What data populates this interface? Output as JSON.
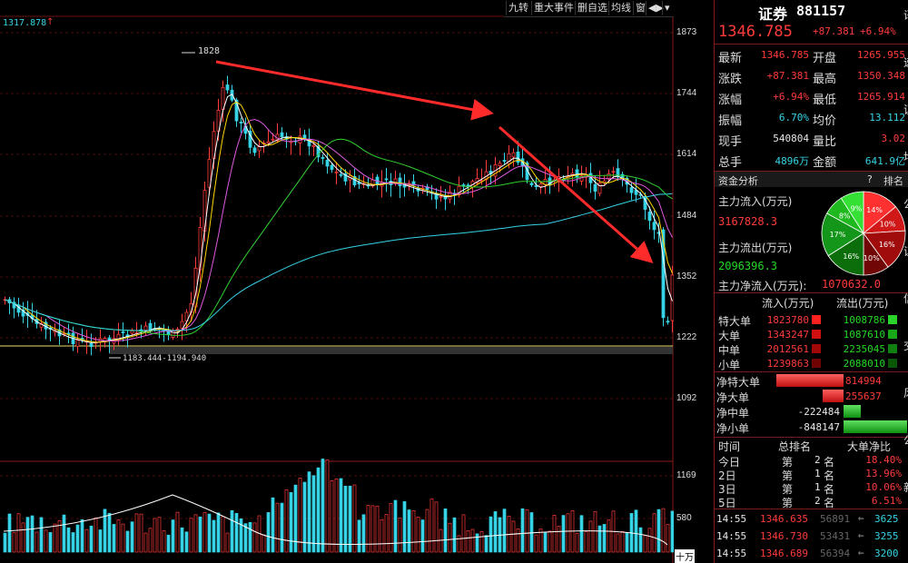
{
  "colors": {
    "up": "#ff3b3b",
    "down": "#26d926",
    "accent": "#36d3e6",
    "bg": "#000000"
  },
  "toolbar": {
    "items": [
      "九转",
      "重大事件",
      "删自选",
      "均线",
      "窗"
    ],
    "arrow_label": "◀▶"
  },
  "chart": {
    "top_value": "1317.878",
    "high_label": "1828",
    "low_label": "1183.444-1194.940",
    "price_axis": [
      "1873",
      "1744",
      "1614",
      "1484",
      "1352",
      "1222",
      "1092"
    ],
    "volume_axis": [
      "1169",
      "580",
      "十万"
    ]
  },
  "quote": {
    "name": "证券",
    "code": "881157",
    "price": "1346.785",
    "change": "+87.381",
    "pct": "+6.94%",
    "rows": [
      {
        "l1": "最新",
        "v1": "1346.785",
        "c1": "red",
        "l2": "开盘",
        "v2": "1265.955",
        "c2": "red"
      },
      {
        "l1": "涨跌",
        "v1": "+87.381",
        "c1": "red",
        "l2": "最高",
        "v2": "1350.348",
        "c2": "red"
      },
      {
        "l1": "涨幅",
        "v1": "+6.94%",
        "c1": "red",
        "l2": "最低",
        "v2": "1265.914",
        "c2": "red"
      },
      {
        "l1": "振幅",
        "v1": "6.70%",
        "c1": "cyan",
        "l2": "均价",
        "v2": "13.112",
        "c2": "cyan"
      },
      {
        "l1": "现手",
        "v1": "540804",
        "c1": "white",
        "l2": "量比",
        "v2": "3.02",
        "c2": "red"
      },
      {
        "l1": "总手",
        "v1": "4896万",
        "c1": "cyan",
        "l2": "金额",
        "v2": "641.9亿",
        "c2": "cyan"
      }
    ]
  },
  "fund": {
    "title": "资金分析",
    "help": "?",
    "rank": "排名",
    "inflow_label": "主力流入(万元)",
    "inflow_value": "3167828.3",
    "outflow_label": "主力流出(万元)",
    "outflow_value": "2096396.3",
    "net_label": "主力净流入(万元):",
    "net_value": "1070632.0",
    "pie": [
      {
        "label": "14%",
        "value": 14,
        "color": "#ff3030"
      },
      {
        "label": "10%",
        "value": 10,
        "color": "#d01818"
      },
      {
        "label": "16%",
        "value": 16,
        "color": "#a00c0c"
      },
      {
        "label": "10%",
        "value": 10,
        "color": "#700606"
      },
      {
        "label": "16%",
        "value": 16,
        "color": "#0b6e0b"
      },
      {
        "label": "17%",
        "value": 17,
        "color": "#14961a"
      },
      {
        "label": "8%",
        "value": 8,
        "color": "#1fb81f"
      },
      {
        "label": "9%",
        "value": 9,
        "color": "#35e035"
      }
    ]
  },
  "flows": {
    "header": [
      "流入(万元)",
      "流出(万元)"
    ],
    "rows": [
      {
        "label": "特大单",
        "in": "1823780",
        "out": "1008786",
        "inc": "#ff2020",
        "outc": "#2bd42b"
      },
      {
        "label": "大单",
        "in": "1343247",
        "out": "1087610",
        "inc": "#d01010",
        "outc": "#18a818"
      },
      {
        "label": "中单",
        "in": "2012561",
        "out": "2235045",
        "inc": "#a00808",
        "outc": "#108010"
      },
      {
        "label": "小单",
        "in": "1239863",
        "out": "2088010",
        "inc": "#700404",
        "outc": "#085808"
      }
    ]
  },
  "net": {
    "rows": [
      {
        "label": "净特大单",
        "value": "814994",
        "frac": 1.0,
        "sign": 1
      },
      {
        "label": "净大单",
        "value": "255637",
        "frac": 0.31,
        "sign": 1
      },
      {
        "label": "净中单",
        "value": "-222484",
        "frac": 0.27,
        "sign": -1
      },
      {
        "label": "净小单",
        "value": "-848147",
        "frac": 1.0,
        "sign": -1
      }
    ]
  },
  "rank": {
    "header": [
      "时间",
      "总排名",
      "大单净比"
    ],
    "rows": [
      {
        "t": "今日",
        "d": "第",
        "n": "2",
        "u": "名",
        "p": "18.40%"
      },
      {
        "t": "2日",
        "d": "第",
        "n": "1",
        "u": "名",
        "p": "13.96%"
      },
      {
        "t": "3日",
        "d": "第",
        "n": "1",
        "u": "名",
        "p": "10.06%"
      },
      {
        "t": "5日",
        "d": "第",
        "n": "2",
        "u": "名",
        "p": "6.51%"
      }
    ]
  },
  "ticks": [
    {
      "time": "14:55",
      "price": "1346.635",
      "vol": "56891",
      "arrow": "⇐",
      "amt": "3625"
    },
    {
      "time": "14:55",
      "price": "1346.730",
      "vol": "53431",
      "arrow": "⇐",
      "amt": "3255"
    },
    {
      "time": "14:55",
      "price": "1346.689",
      "vol": "56394",
      "arrow": "⇐",
      "amt": "3200"
    }
  ],
  "side_strip": [
    "讯",
    "速",
    "证",
    "均",
    "公",
    "证",
    "信",
    "交",
    "风",
    "公",
    "新"
  ]
}
